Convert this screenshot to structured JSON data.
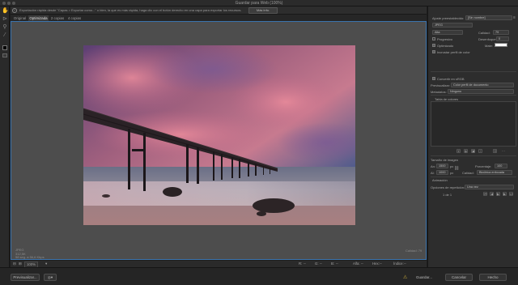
{
  "window": {
    "title": "Guardar para Web (100%)"
  },
  "banner": {
    "text": "Exportación rápida desde \"Capas > Exportar como...\" o bien, la que es más rápida, haga clic con el botón derecho en una capa para exportar los recursos.",
    "button_label": "Más info."
  },
  "tabs": [
    {
      "label": "Original"
    },
    {
      "label": "Optimizada"
    },
    {
      "label": "2 copias"
    },
    {
      "label": "4 copias"
    }
  ],
  "preview": {
    "info_lines": [
      "JPEG",
      "312,5K",
      "58 seg. a 56,6 Kbps"
    ],
    "info_right": "Calidad: 79"
  },
  "bottom": {
    "zoom": "100%",
    "r_label": "R:",
    "r_value": "--",
    "g_label": "G:",
    "g_value": "--",
    "b_label": "B:",
    "b_value": "--",
    "alpha_label": "Alfa:",
    "alpha_value": "--",
    "hex_label": "Hex:",
    "hex_value": "--",
    "index_label": "Índice:",
    "index_value": "--"
  },
  "footer": {
    "preview_label": "Previsualizar...",
    "done_label": "Hecho",
    "save_label": "Guardar...",
    "cancel_label": "Cancelar"
  },
  "panel": {
    "preset_label": "Ajuste preestablecido:",
    "preset_value": "[Sin nombre]",
    "format_value": "JPEG",
    "quality_level": "Alta",
    "quality_label": "Calidad:",
    "quality_value": "79",
    "progressive_label": "Progresivo",
    "blur_label": "Desenfoque:",
    "blur_value": "0",
    "optimized_label": "Optimizado",
    "matte_label": "Mate:",
    "embed_profile_label": "Incrustar perfil de color",
    "convert_srgb_label": "Convertir en sRGB",
    "preview_label": "Previsualizar:",
    "preview_value": "Color perfil de documento",
    "metadata_label": "Metadatos:",
    "metadata_value": "Ninguno",
    "color_table_label": "Tabla de colores",
    "image_size_label": "Tamaño de imagen",
    "w_label": "An:",
    "w_value": "1500",
    "w_unit": "px",
    "percent_label": "Porcentaje:",
    "percent_value": "100",
    "h_label": "Al:",
    "h_value": "1000",
    "h_unit": "px",
    "quality2_label": "Calidad:",
    "quality2_value": "Bicúbica enfocada",
    "animation_label": "Animación",
    "loop_label": "Opciones de repetición:",
    "loop_value": "Una vez",
    "frame_counter": "1 de 1",
    "accent": "#3b73ad"
  }
}
